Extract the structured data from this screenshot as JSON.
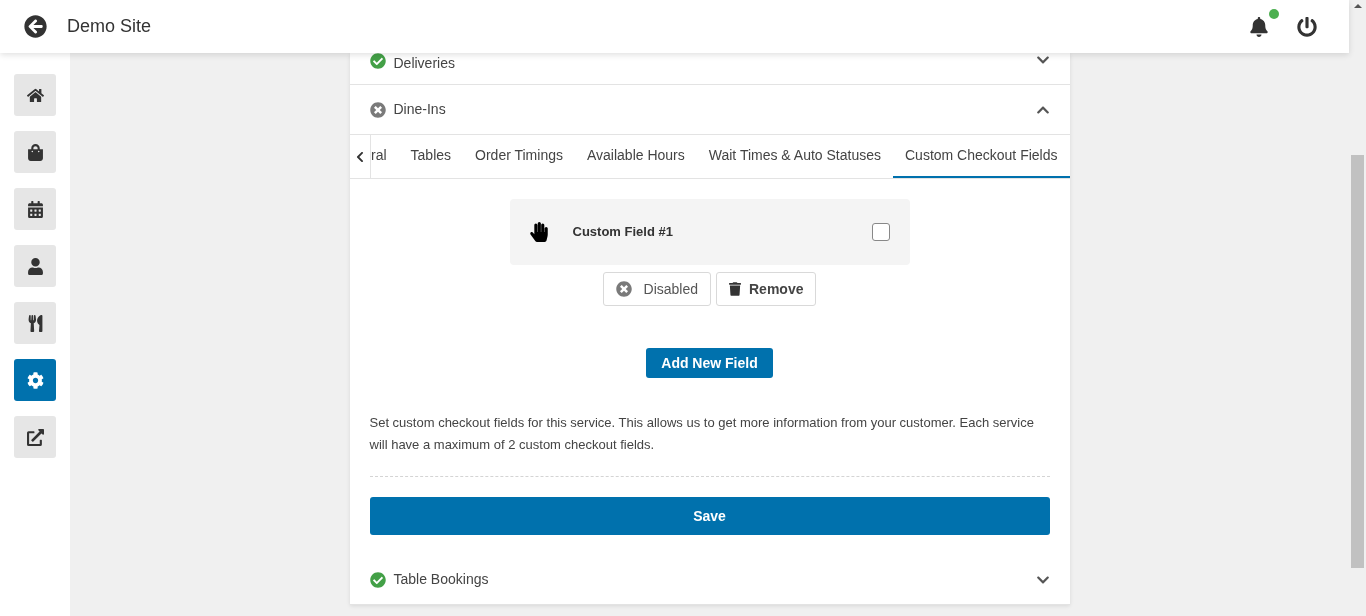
{
  "header": {
    "title": "Demo Site",
    "has_unread": true
  },
  "sidebar": {
    "items": [
      {
        "selected": false
      },
      {
        "selected": false
      },
      {
        "selected": false
      },
      {
        "selected": false
      },
      {
        "selected": false
      },
      {
        "selected": true
      },
      {
        "selected": false
      }
    ]
  },
  "services": [
    {
      "name": "Deliveries",
      "enabled": true,
      "expanded": false
    },
    {
      "name": "Dine-Ins",
      "enabled": false,
      "expanded": true
    },
    {
      "name": "Table Bookings",
      "enabled": true,
      "expanded": false
    }
  ],
  "panel": {
    "tabs": [
      {
        "label": "ral",
        "selected": false
      },
      {
        "label": "Tables",
        "selected": false
      },
      {
        "label": "Order Timings",
        "selected": false
      },
      {
        "label": "Available Hours",
        "selected": false
      },
      {
        "label": "Wait Times & Auto Statuses",
        "selected": false
      },
      {
        "label": "Custom Checkout Fields",
        "selected": true
      }
    ],
    "fields": [
      {
        "name": "Custom Field #1",
        "checked": false,
        "active": false,
        "status": "Disabled",
        "remove": "Remove"
      }
    ],
    "add_button": "Add New Field",
    "description": "Set custom checkout fields for this service. This allows us to get more information from your customer. Each service will have a maximum of 2 custom checkout fields.",
    "save_button": "Save"
  }
}
